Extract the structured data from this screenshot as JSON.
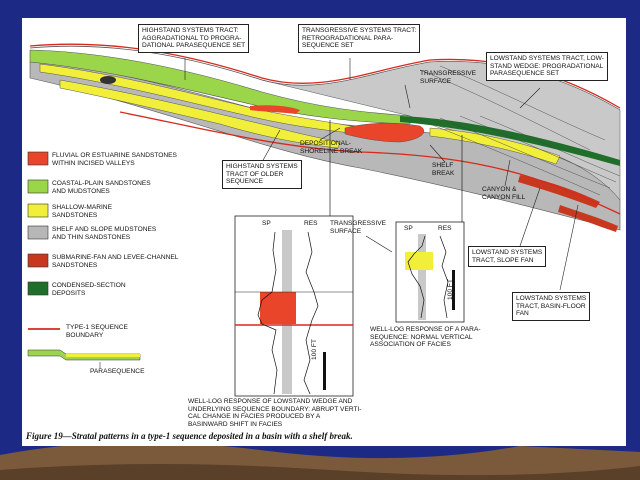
{
  "callouts": {
    "highstand": "HIGHSTAND SYSTEMS TRACT:\nAGGRADATIONAL TO PROGRA-\nDATIONAL PARASEQUENCE SET",
    "transgressive_tract": "TRANSGRESSIVE SYSTEMS TRACT:\nRETROGRADATIONAL PARA-\nSEQUENCE SET",
    "lowstand_wedge": "LOWSTAND SYSTEMS TRACT, LOW-\nSTAND WEDGE: PROGRADATIONAL\nPARASEQUENCE SET",
    "transgressive_surface_top": "TRANSGRESSIVE\nSURFACE",
    "depositional_break": "DEPOSITIONAL-\nSHORELINE BREAK",
    "shelf_break": "SHELF\nBREAK",
    "highstand_older": "HIGHSTAND SYSTEMS\nTRACT OF OLDER\nSEQUENCE",
    "canyon": "CANYON &\nCANYON FILL",
    "transgressive_surface_mid": "TRANSGRESSIVE\nSURFACE",
    "lowstand_slope_fan": "LOWSTAND SYSTEMS\nTRACT, SLOPE FAN",
    "lowstand_basin_fan": "LOWSTAND SYSTEMS\nTRACT, BASIN-FLOOR\nFAN"
  },
  "legend": [
    {
      "label": "FLUVIAL OR ESTUARINE SANDSTONES\nWITHIN INCISED VALLEYS",
      "color": "#e8452a"
    },
    {
      "label": "COASTAL-PLAIN SANDSTONES\nAND MUDSTONES",
      "color": "#9bd64a"
    },
    {
      "label": "SHALLOW-MARINE\nSANDSTONES",
      "color": "#f2ef3a"
    },
    {
      "label": "SHELF AND SLOPE MUDSTONES\nAND THIN SANDSTONES",
      "color": "#b7b7b7"
    },
    {
      "label": "SUBMARINE-FAN AND LEVEE-CHANNEL\nSANDSTONES",
      "color": "#c8381e"
    },
    {
      "label": "CONDENSED-SECTION\nDEPOSITS",
      "color": "#1f6f2a"
    }
  ],
  "legend_lines": {
    "boundary": "TYPE-1 SEQUENCE\nBOUNDARY",
    "parasequence": "PARASEQUENCE"
  },
  "well_log_left": {
    "sp": "SP",
    "res": "RES",
    "scale": "100 FT",
    "caption": "WELL-LOG RESPONSE OF LOWSTAND WEDGE AND\nUNDERLYING SEQUENCE BOUNDARY: ABRUPT VERTI-\nCAL CHANGE IN FACIES PRODUCED BY A\nBASINWARD SHIFT IN FACIES"
  },
  "well_log_right": {
    "sp": "SP",
    "res": "RES",
    "scale": "100 FT",
    "caption": "WELL-LOG RESPONSE OF A PARA-\nSEQUENCE: NORMAL VERTICAL\nASSOCIATION OF FACIES"
  },
  "figure_caption": "Figure 19—Stratal patterns in a type-1 sequence deposited in a basin with a shelf break.",
  "colors": {
    "background": "#1c2a86",
    "page": "#ffffff",
    "boundary": "#d62a1e"
  }
}
